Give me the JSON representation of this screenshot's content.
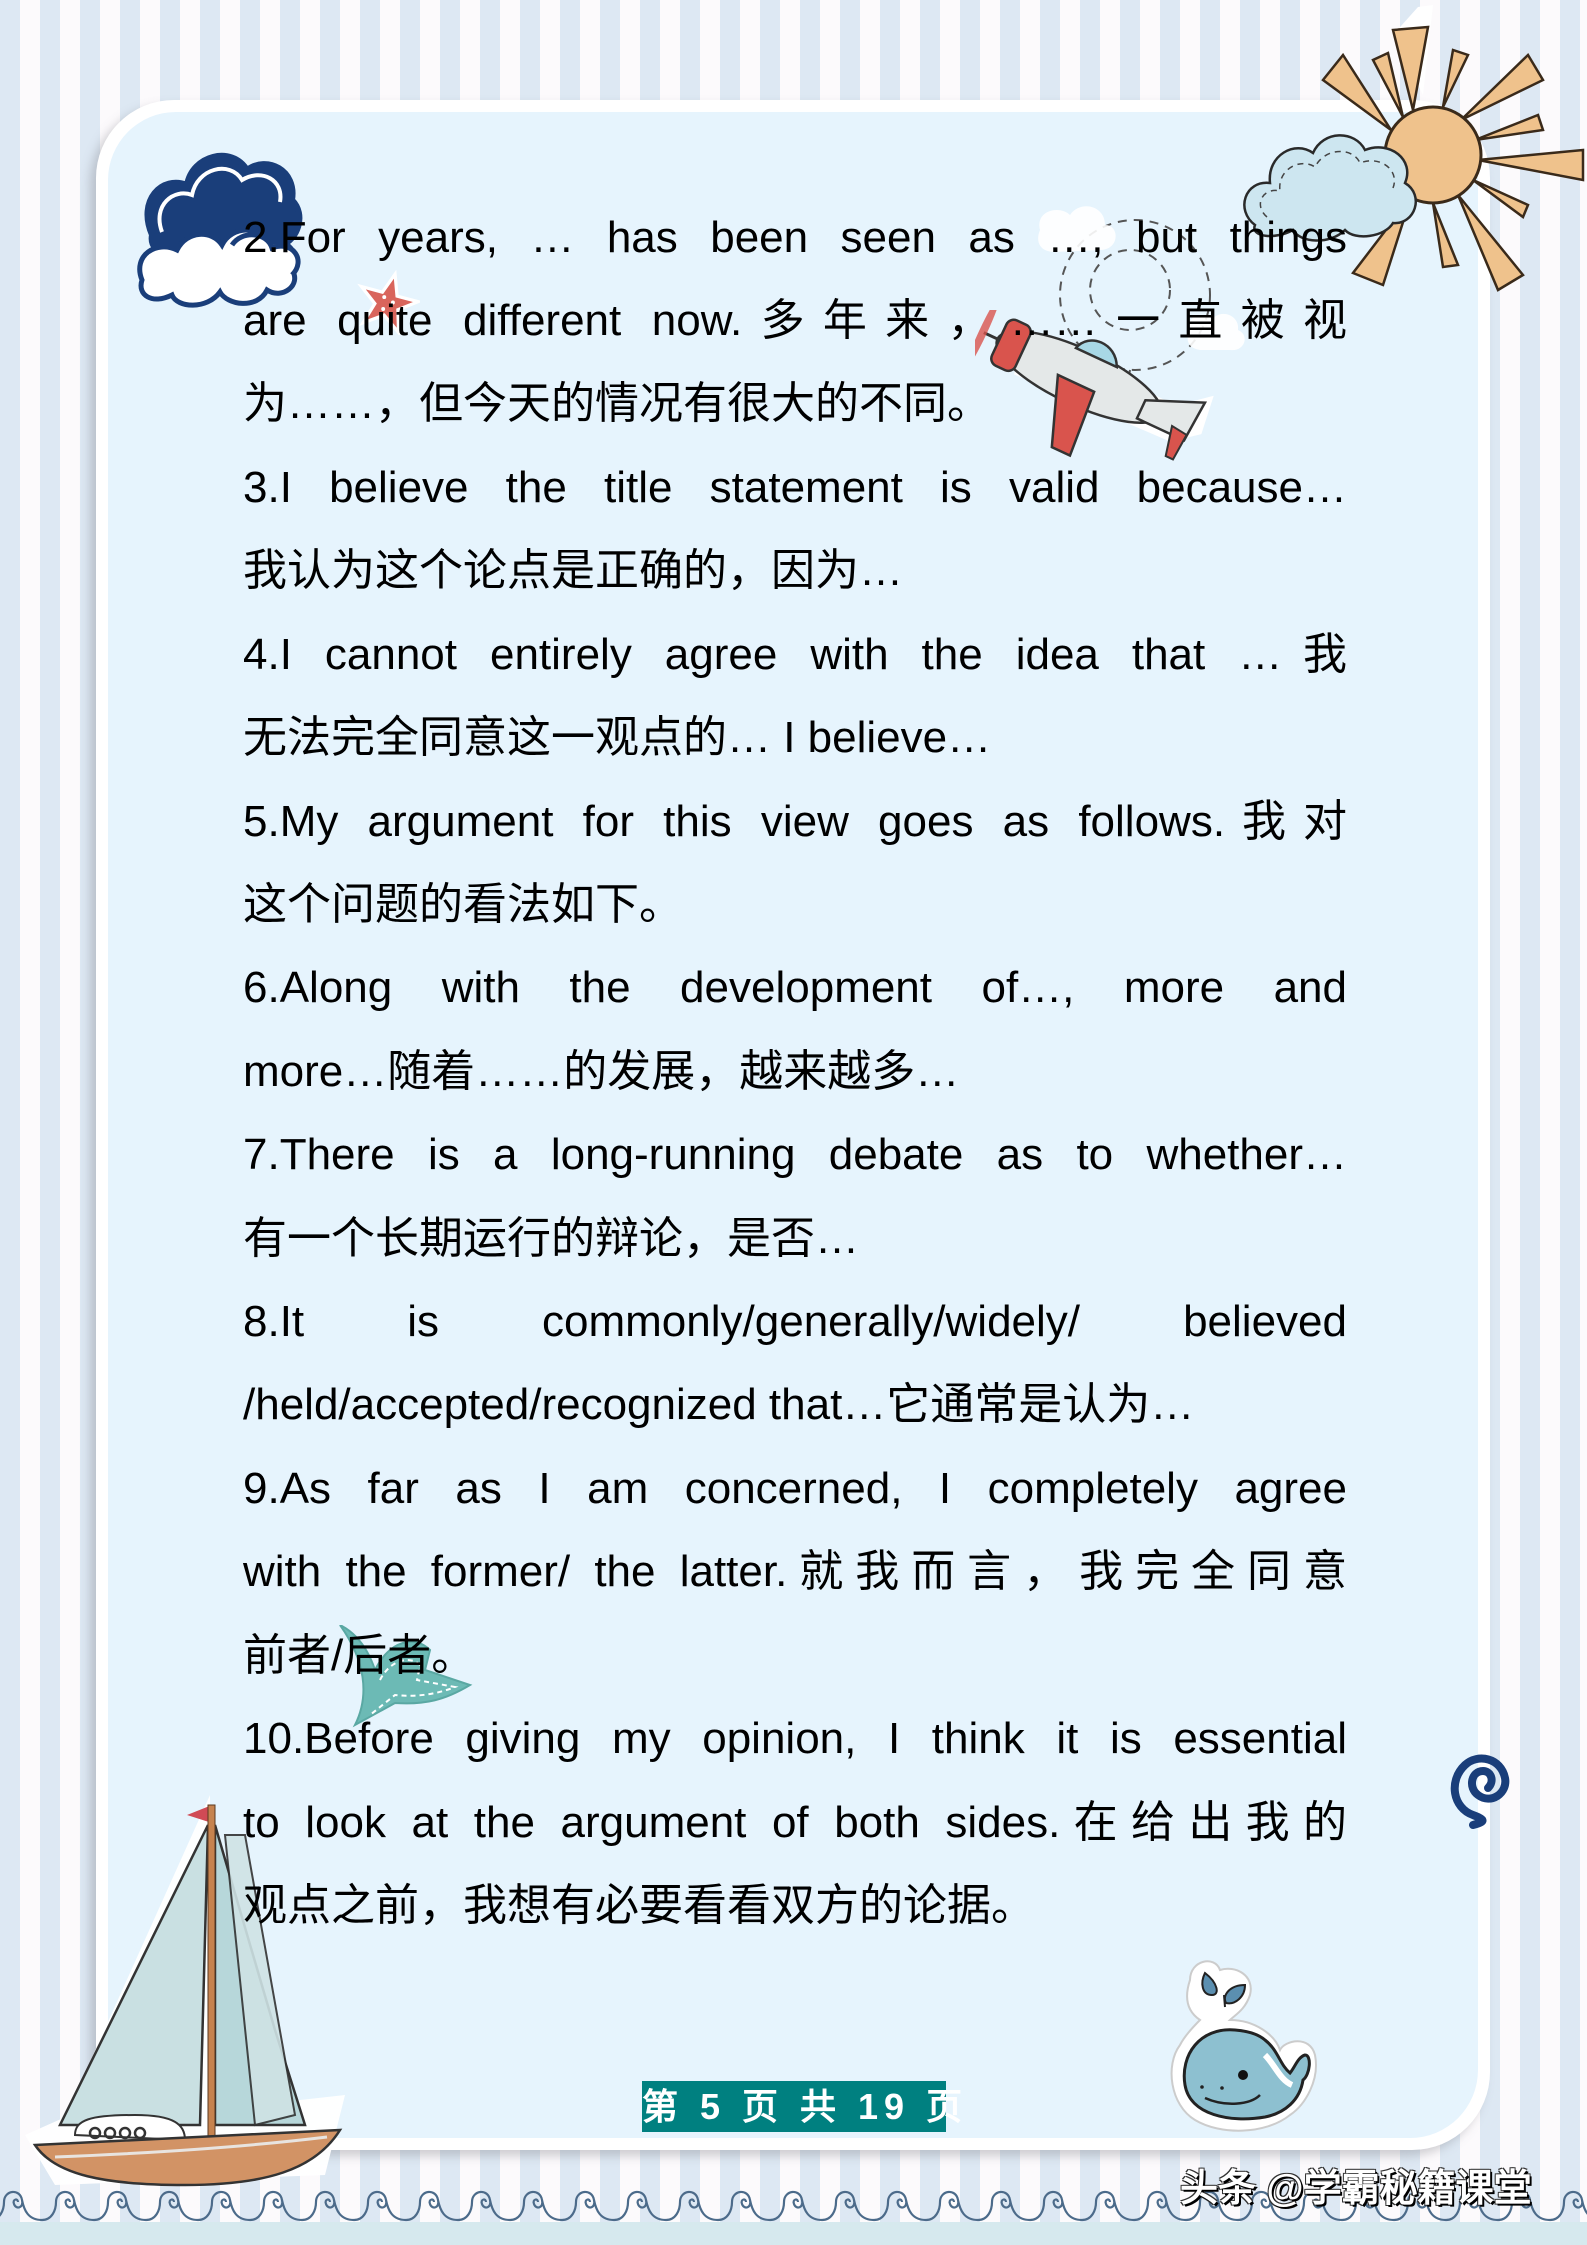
{
  "page": {
    "background_stripe_colors": [
      "#dde8f3",
      "#fcfafc"
    ],
    "card_color": "#e6f4fd",
    "accent_color": "#008080"
  },
  "content": {
    "lines": [
      {
        "text": "2.For years,  …  has been seen as  …,    but things",
        "justify": true
      },
      {
        "text": "are  quite  different  now.多年来，……一直被视",
        "justify": true
      },
      {
        "text": "为……，但今天的情况有很大的不同。",
        "justify": false
      },
      {
        "text": "3.I believe the title statement is valid because…",
        "justify": true
      },
      {
        "text": "我认为这个论点是正确的，因为…",
        "justify": false
      },
      {
        "text": "4.I cannot entirely agree with the idea that  …我",
        "justify": true
      },
      {
        "text": "无法完全同意这一观点的…  I believe…",
        "justify": false
      },
      {
        "text": "5.My argument for this view goes as follows.我对",
        "justify": true
      },
      {
        "text": "这个问题的看法如下。",
        "justify": false
      },
      {
        "text": "6.Along with the development of…,    more and",
        "justify": true
      },
      {
        "text": "more…随着……的发展，越来越多…",
        "justify": false
      },
      {
        "text": "7.There is a long-running debate as to whether…",
        "justify": true
      },
      {
        "text": "有一个长期运行的辩论，是否…",
        "justify": false
      },
      {
        "text": "8.It    is    commonly/generally/widely/    believed",
        "justify": true
      },
      {
        "text": "/held/accepted/recognized that…它通常是认为…",
        "justify": false
      },
      {
        "text": "9.As  far  as  I  am  concerned,  I  completely  agree",
        "justify": true
      },
      {
        "text": "with the former/ the latter.就我而言，我完全同意",
        "justify": true
      },
      {
        "text": "前者/后者。",
        "justify": false
      },
      {
        "text": "10.Before giving my opinion, I think it is essential",
        "justify": true
      },
      {
        "text": "to look at the argument of both sides.在给出我的",
        "justify": true
      },
      {
        "text": "观点之前，我想有必要看看双方的论据。",
        "justify": false
      }
    ]
  },
  "footer": {
    "page_indicator": "第 5 页 共 19 页",
    "current_page": 5,
    "total_pages": 19
  },
  "watermark": {
    "text": "头条 @学霸秘籍课堂"
  },
  "decorations": {
    "icons": [
      "cloud-icon",
      "star-icon",
      "sun-icon",
      "airplane-icon",
      "spiral-icon",
      "bird-icon",
      "sailboat-icon",
      "whale-icon",
      "wave-border"
    ]
  }
}
